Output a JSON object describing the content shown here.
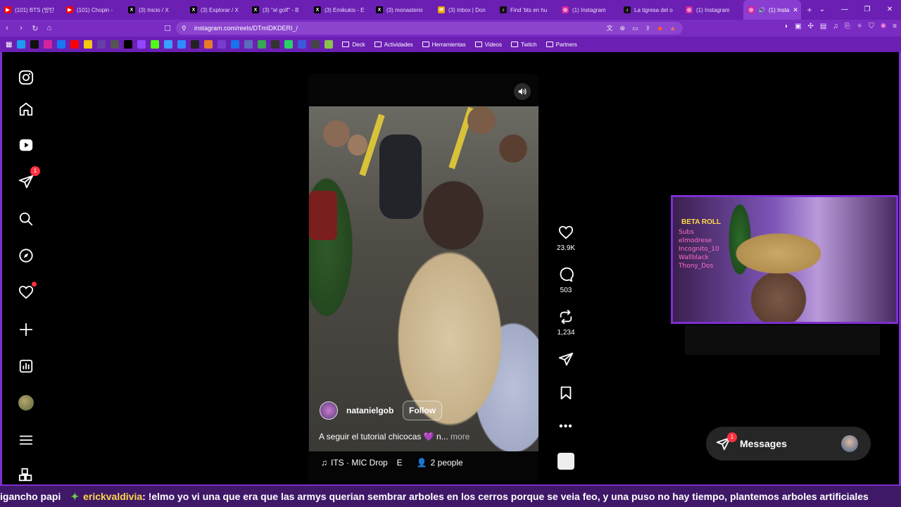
{
  "browser": {
    "tabs": [
      {
        "title": "(101) BTS (방탄",
        "fav_color": "#ff0000",
        "fav": "▶"
      },
      {
        "title": "(101) Chopin -",
        "fav_color": "#ff0000",
        "fav": "▶"
      },
      {
        "title": "(3) Inicio / X",
        "fav_color": "#000000",
        "fav": "X"
      },
      {
        "title": "(3) Explorar / X",
        "fav_color": "#000000",
        "fav": "X"
      },
      {
        "title": "(3) \"el golf\" - B",
        "fav_color": "#000000",
        "fav": "X"
      },
      {
        "title": "(3) Emikukis - E",
        "fav_color": "#000000",
        "fav": "X"
      },
      {
        "title": "(3) monasterio",
        "fav_color": "#000000",
        "fav": "X"
      },
      {
        "title": "(3) Inbox | Don",
        "fav_color": "#e6a700",
        "fav": "✉"
      },
      {
        "title": "Find 'bts en hu",
        "fav_color": "#111111",
        "fav": "♪"
      },
      {
        "title": "(1) Instagram",
        "fav_color": "#d6249f",
        "fav": "◎"
      },
      {
        "title": "La tigresa del o",
        "fav_color": "#111111",
        "fav": "♪"
      },
      {
        "title": "(1) Instagram",
        "fav_color": "#d6249f",
        "fav": "◎"
      }
    ],
    "active_tab": {
      "title": "(1) Insta",
      "fav_color": "#d6249f",
      "fav": "◎"
    },
    "url": "instagram.com/reels/DTmIDKDERI_/",
    "bookmarks": [
      "Deck",
      "Actividades",
      "Herramientas",
      "Videos",
      "Twitch",
      "Partners"
    ]
  },
  "sidebar": {
    "notifications_badge": "1"
  },
  "reel": {
    "username": "natanielgob",
    "follow_label": "Follow",
    "caption": "A seguir el tutorial chicocas 💜 n...",
    "more_label": "more",
    "audio": "ITS · MIC Drop",
    "audio_extra": "E",
    "people": "2 people"
  },
  "actions": {
    "likes": "23.9K",
    "comments": "503",
    "reposts": "1,234"
  },
  "messages": {
    "label": "Messages",
    "badge": "1"
  },
  "cam": {
    "title": "BETA ROLL",
    "overlay_lines": [
      "Subs",
      "elmodrese",
      "Incognito_10",
      "Wallblack",
      "Thony_Dos"
    ]
  },
  "ticker": {
    "prefix": "igancho papi",
    "user": "erickvaldivia",
    "message": ": !elmo yo vi una que era que las armys querian sembrar arboles en los cerros porque se veia feo, y una puso no hay tiempo, plantemos arboles artificiales"
  },
  "colors": {
    "browser_purple": "#6b1fb3",
    "frame_purple": "#7d2fd0",
    "badge_red": "#ff3040"
  }
}
